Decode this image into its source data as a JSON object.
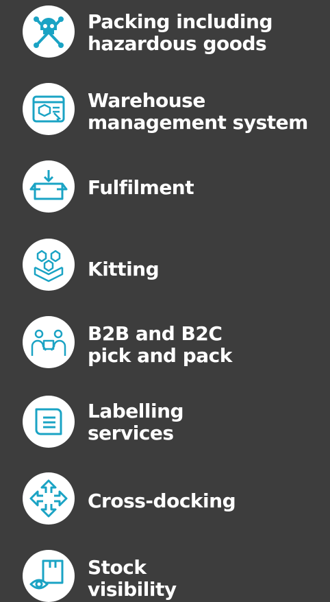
{
  "colors": {
    "background": "#3d3d3d",
    "circle": "#ffffff",
    "icon": "#1aa3c4",
    "text": "#ffffff"
  },
  "services": [
    {
      "icon": "skull-crossbones-icon",
      "lines": [
        "Packing including",
        "hazardous goods"
      ]
    },
    {
      "icon": "warehouse-management-icon",
      "lines": [
        "Warehouse",
        "management system"
      ]
    },
    {
      "icon": "open-box-icon",
      "lines": [
        "Fulfilment"
      ]
    },
    {
      "icon": "stacked-boxes-icon",
      "lines": [
        "Kitting"
      ]
    },
    {
      "icon": "people-handing-box-icon",
      "lines": [
        "B2B and B2C",
        "pick and pack"
      ]
    },
    {
      "icon": "label-document-icon",
      "lines": [
        "Labelling",
        "services"
      ]
    },
    {
      "icon": "four-way-arrows-icon",
      "lines": [
        "Cross-docking"
      ]
    },
    {
      "icon": "eye-box-icon",
      "lines": [
        "Stock",
        "visibility"
      ]
    }
  ]
}
